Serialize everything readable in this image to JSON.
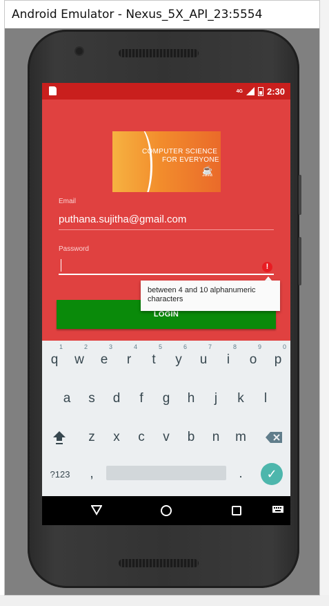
{
  "window": {
    "title": "Android Emulator - Nexus_5X_API_23:5554"
  },
  "status_bar": {
    "network": "4G",
    "time": "2:30"
  },
  "banner": {
    "line1": "COMPUTER SCIENCE",
    "line2": "FOR EVERYONE",
    "logo_text": "Java"
  },
  "form": {
    "email_label": "Email",
    "email_value": "puthana.sujitha@gmail.com",
    "password_label": "Password",
    "password_value": "",
    "error_tooltip": "between 4 and 10 alphanumeric characters",
    "login_label": "LOGIN"
  },
  "keyboard": {
    "row1": [
      {
        "k": "q",
        "h": "1"
      },
      {
        "k": "w",
        "h": "2"
      },
      {
        "k": "e",
        "h": "3"
      },
      {
        "k": "r",
        "h": "4"
      },
      {
        "k": "t",
        "h": "5"
      },
      {
        "k": "y",
        "h": "6"
      },
      {
        "k": "u",
        "h": "7"
      },
      {
        "k": "i",
        "h": "8"
      },
      {
        "k": "o",
        "h": "9"
      },
      {
        "k": "p",
        "h": "0"
      }
    ],
    "row2": [
      "a",
      "s",
      "d",
      "f",
      "g",
      "h",
      "j",
      "k",
      "l"
    ],
    "row3": [
      "z",
      "x",
      "c",
      "v",
      "b",
      "n",
      "m"
    ],
    "symbols_label": "?123",
    "comma": ",",
    "period": "."
  },
  "colors": {
    "app_background": "#e04140",
    "status_bar": "#c91f1d",
    "login_button": "#0a8a0a",
    "enter_key": "#4db6ac",
    "error_icon": "#e81c22"
  },
  "icons": {
    "status_left": "sd-card-icon",
    "status_right": [
      "signal-icon",
      "battery-icon"
    ],
    "error": "error-icon",
    "nav": [
      "back-icon",
      "home-icon",
      "recents-icon",
      "keyboard-switch-icon"
    ],
    "keyboard": [
      "shift-icon",
      "backspace-icon",
      "enter-check-icon"
    ]
  }
}
